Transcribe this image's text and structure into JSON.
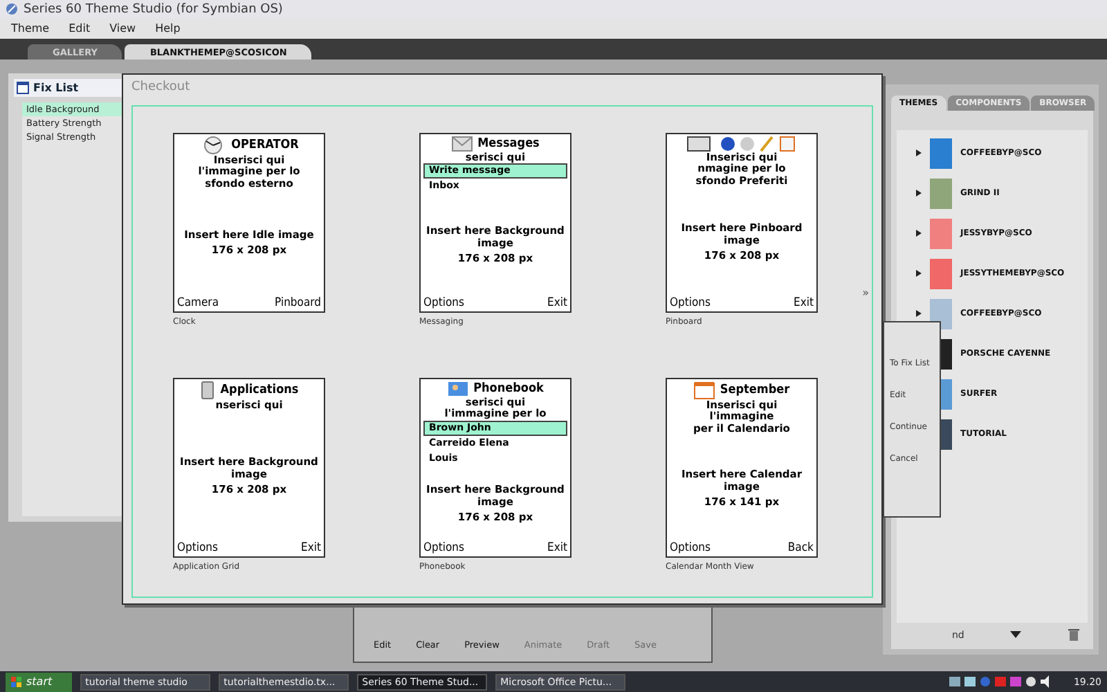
{
  "window": {
    "title": "Series 60 Theme Studio (for Symbian OS)"
  },
  "menu": [
    "Theme",
    "Edit",
    "View",
    "Help"
  ],
  "tabs": [
    {
      "label": "GALLERY",
      "selected": false
    },
    {
      "label": "BLANKTHEMEP@SCOSICON",
      "selected": true
    }
  ],
  "fix_list": {
    "title": "Fix List",
    "items": [
      {
        "label": "Idle Background",
        "selected": true
      },
      {
        "label": "Battery Strength",
        "selected": false
      },
      {
        "label": "Signal Strength",
        "selected": false
      }
    ]
  },
  "toolbar": [
    {
      "label": "Edit",
      "disabled": false
    },
    {
      "label": "Clear",
      "disabled": false
    },
    {
      "label": "Preview",
      "disabled": false
    },
    {
      "label": "Animate",
      "disabled": true
    },
    {
      "label": "Draft",
      "disabled": true
    },
    {
      "label": "Save",
      "disabled": true
    }
  ],
  "checkout": {
    "title": "Checkout",
    "more": "»",
    "phones": [
      {
        "kind": "clock",
        "caption": "Clock",
        "title": "OPERATOR",
        "lines": [
          "Inserisci qui",
          "l'immagine per lo",
          "sfondo esterno"
        ],
        "insert": "Insert here Idle image",
        "size": "176 x 208 px",
        "left": "Camera",
        "right": "Pinboard"
      },
      {
        "kind": "messages",
        "caption": "Messaging",
        "title": "Messages",
        "lines": [
          "serisci qui"
        ],
        "items": [
          {
            "label": "Write message",
            "selected": true
          },
          {
            "label": "Inbox",
            "selected": false
          }
        ],
        "insert": "Insert here Background image",
        "size": "176 x 208 px",
        "left": "Options",
        "right": "Exit"
      },
      {
        "kind": "pinboard",
        "caption": "Pinboard",
        "lines": [
          "Inserisci qui",
          "nmagine per lo",
          "sfondo Preferiti"
        ],
        "insert": "Insert here Pinboard image",
        "size": "176 x 208 px",
        "left": "Options",
        "right": "Exit"
      },
      {
        "kind": "apps",
        "caption": "Application Grid",
        "title": "Applications",
        "lines": [
          "nserisci qui"
        ],
        "insert": "Insert here Background image",
        "size": "176 x 208 px",
        "left": "Options",
        "right": "Exit"
      },
      {
        "kind": "phonebook",
        "caption": "Phonebook",
        "title": "Phonebook",
        "lines": [
          "serisci qui",
          "l'immagine per lo"
        ],
        "items": [
          {
            "label": "Brown John",
            "selected": true
          },
          {
            "label": "Carreido Elena",
            "selected": false
          },
          {
            "label": "Louis",
            "selected": false
          }
        ],
        "insert": "Insert here Background image",
        "size": "176 x 208 px",
        "left": "Options",
        "right": "Exit"
      },
      {
        "kind": "calendar",
        "caption": "Calendar Month View",
        "title": "September",
        "lines": [
          "Inserisci qui",
          "l'immagine",
          "per il Calendario"
        ],
        "insert": "Insert here Calendar image",
        "size": "176 x 141 px",
        "left": "Options",
        "right": "Back"
      }
    ]
  },
  "side_menu": [
    "To Fix List",
    "Edit",
    "Continue",
    "Cancel"
  ],
  "themes_panel": {
    "tabs": [
      {
        "label": "THEMES",
        "selected": true
      },
      {
        "label": "COMPONENTS",
        "selected": false
      },
      {
        "label": "BROWSER",
        "selected": false
      }
    ],
    "items": [
      {
        "name": "COFFEEBYP@SCO",
        "color": "#2a7fd0"
      },
      {
        "name": "GRIND II",
        "color": "#8fa67a"
      },
      {
        "name": "JESSYBYP@SCO",
        "color": "#f08080"
      },
      {
        "name": "JESSYTHEMEBYP@SCO",
        "color": "#f06868"
      },
      {
        "name": "COFFEEBYP@SCO",
        "color": "#a9bfd6"
      },
      {
        "name": "PORSCHE CAYENNE",
        "color": "#222222"
      },
      {
        "name": "SURFER",
        "color": "#5b9bd5"
      },
      {
        "name": "TUTORIAL",
        "color": "#3a4a5c"
      }
    ],
    "footer": "nd"
  },
  "taskbar": {
    "start": "start",
    "tasks": [
      {
        "label": "tutorial theme studio",
        "selected": false
      },
      {
        "label": "tutorialthemestdio.tx...",
        "selected": false
      },
      {
        "label": "Series 60 Theme Stud...",
        "selected": true
      },
      {
        "label": "Microsoft Office Pictu...",
        "selected": false
      }
    ],
    "clock": "19.20"
  }
}
